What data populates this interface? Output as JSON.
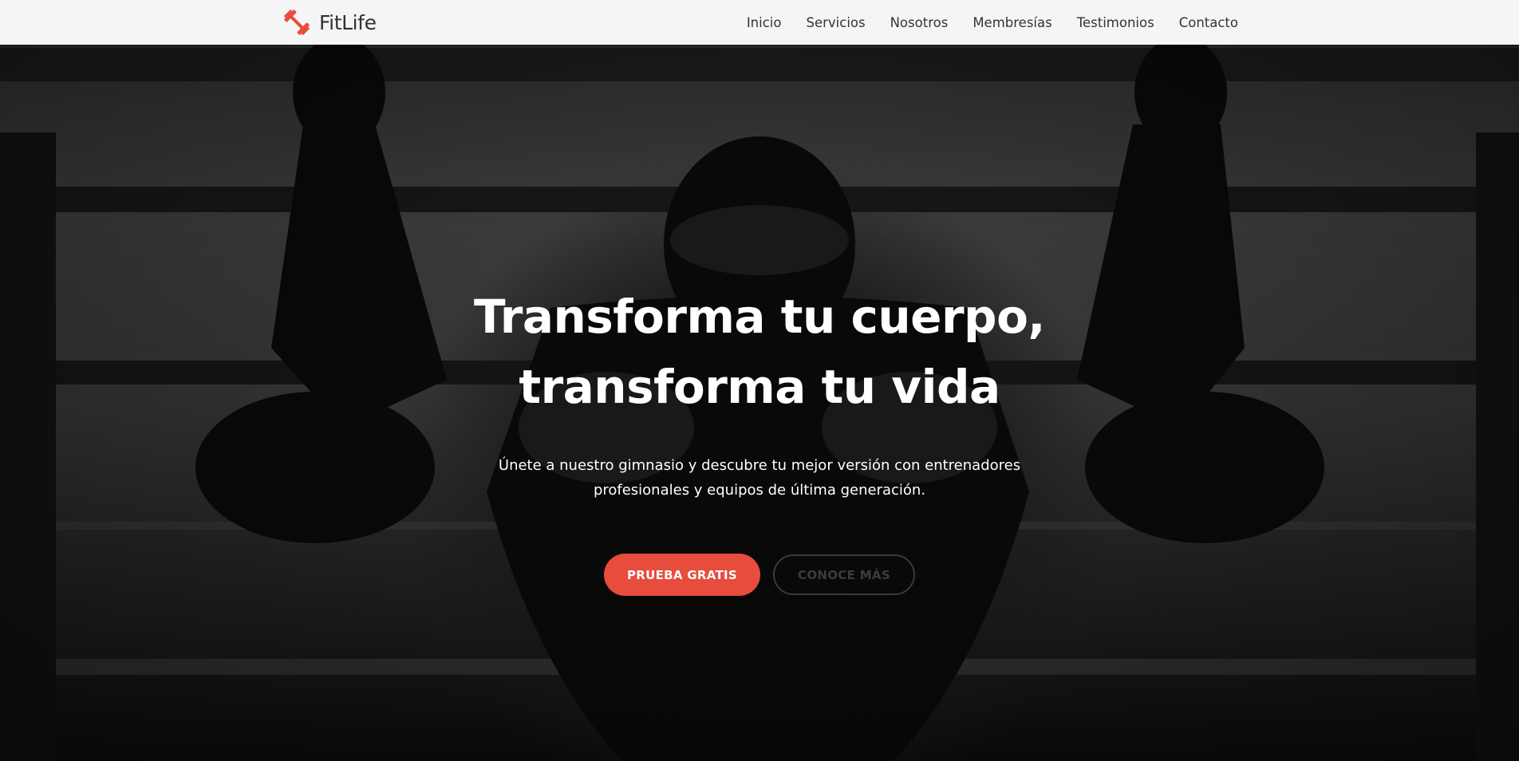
{
  "brand": {
    "name": "FitLife",
    "icon": "dumbbell-icon",
    "accent_color": "#e74c3c"
  },
  "nav": {
    "items": [
      {
        "label": "Inicio"
      },
      {
        "label": "Servicios"
      },
      {
        "label": "Nosotros"
      },
      {
        "label": "Membresías"
      },
      {
        "label": "Testimonios"
      },
      {
        "label": "Contacto"
      }
    ]
  },
  "hero": {
    "title_line1": "Transforma tu cuerpo,",
    "title_line2": "transforma tu vida",
    "subtitle": "Únete a nuestro gimnasio y descubre tu mejor versión con entrenadores profesionales y equipos de última generación.",
    "primary_button": "PRUEBA GRATIS",
    "secondary_button": "CONOCE MÁS",
    "primary_color": "#e74c3c"
  }
}
